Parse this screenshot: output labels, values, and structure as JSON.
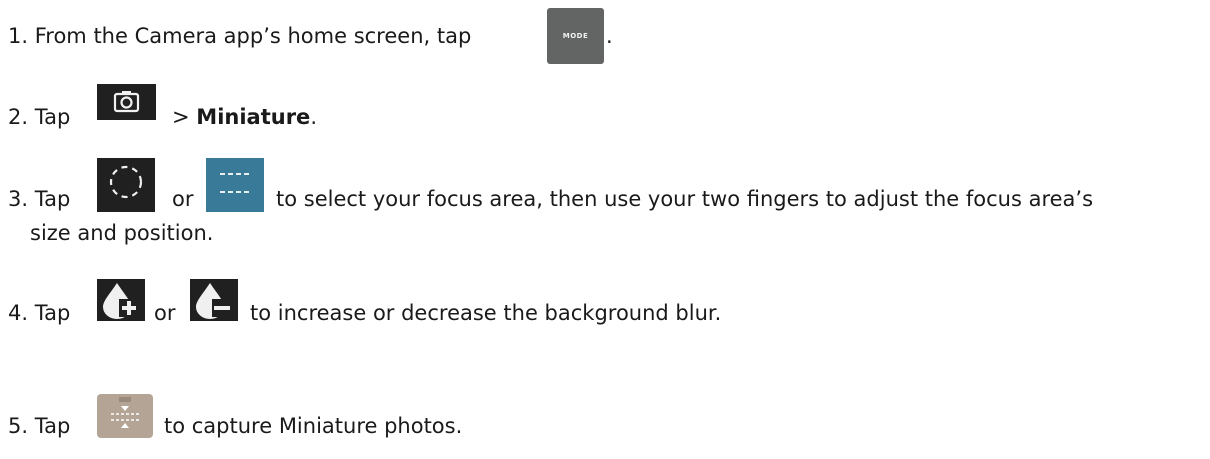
{
  "steps": [
    {
      "num": "1.",
      "text_before": "From the Camera app’s home screen, tap",
      "icon": "mode-button-icon",
      "icon_label": "MODE",
      "text_after": "."
    },
    {
      "num": "2.",
      "text_before": "Tap",
      "icon": "camera-icon",
      "text_after_plain": ">",
      "text_after_bold": "Miniature",
      "text_after_end": "."
    },
    {
      "num": "3.",
      "text_before": "Tap",
      "icon_a": "circle-focus-icon",
      "connector": "or",
      "icon_b": "linear-focus-icon",
      "text_after": "to select your focus area, then use your two fingers to adjust the focus area’s",
      "text_line2": "size and position."
    },
    {
      "num": "4.",
      "text_before": "Tap",
      "icon_a": "blur-increase-icon",
      "connector": "or",
      "icon_b": "blur-decrease-icon",
      "text_after": "to increase or decrease the background blur."
    },
    {
      "num": "5.",
      "text_before": "Tap",
      "icon": "miniature-capture-icon",
      "text_after": "to capture Miniature photos."
    }
  ],
  "colors": {
    "text": "#1a1a1a",
    "mode_button": "#636564",
    "dark_icon": "#202020",
    "blue_icon": "#3a7a99",
    "capture_button": "#b3a495"
  }
}
